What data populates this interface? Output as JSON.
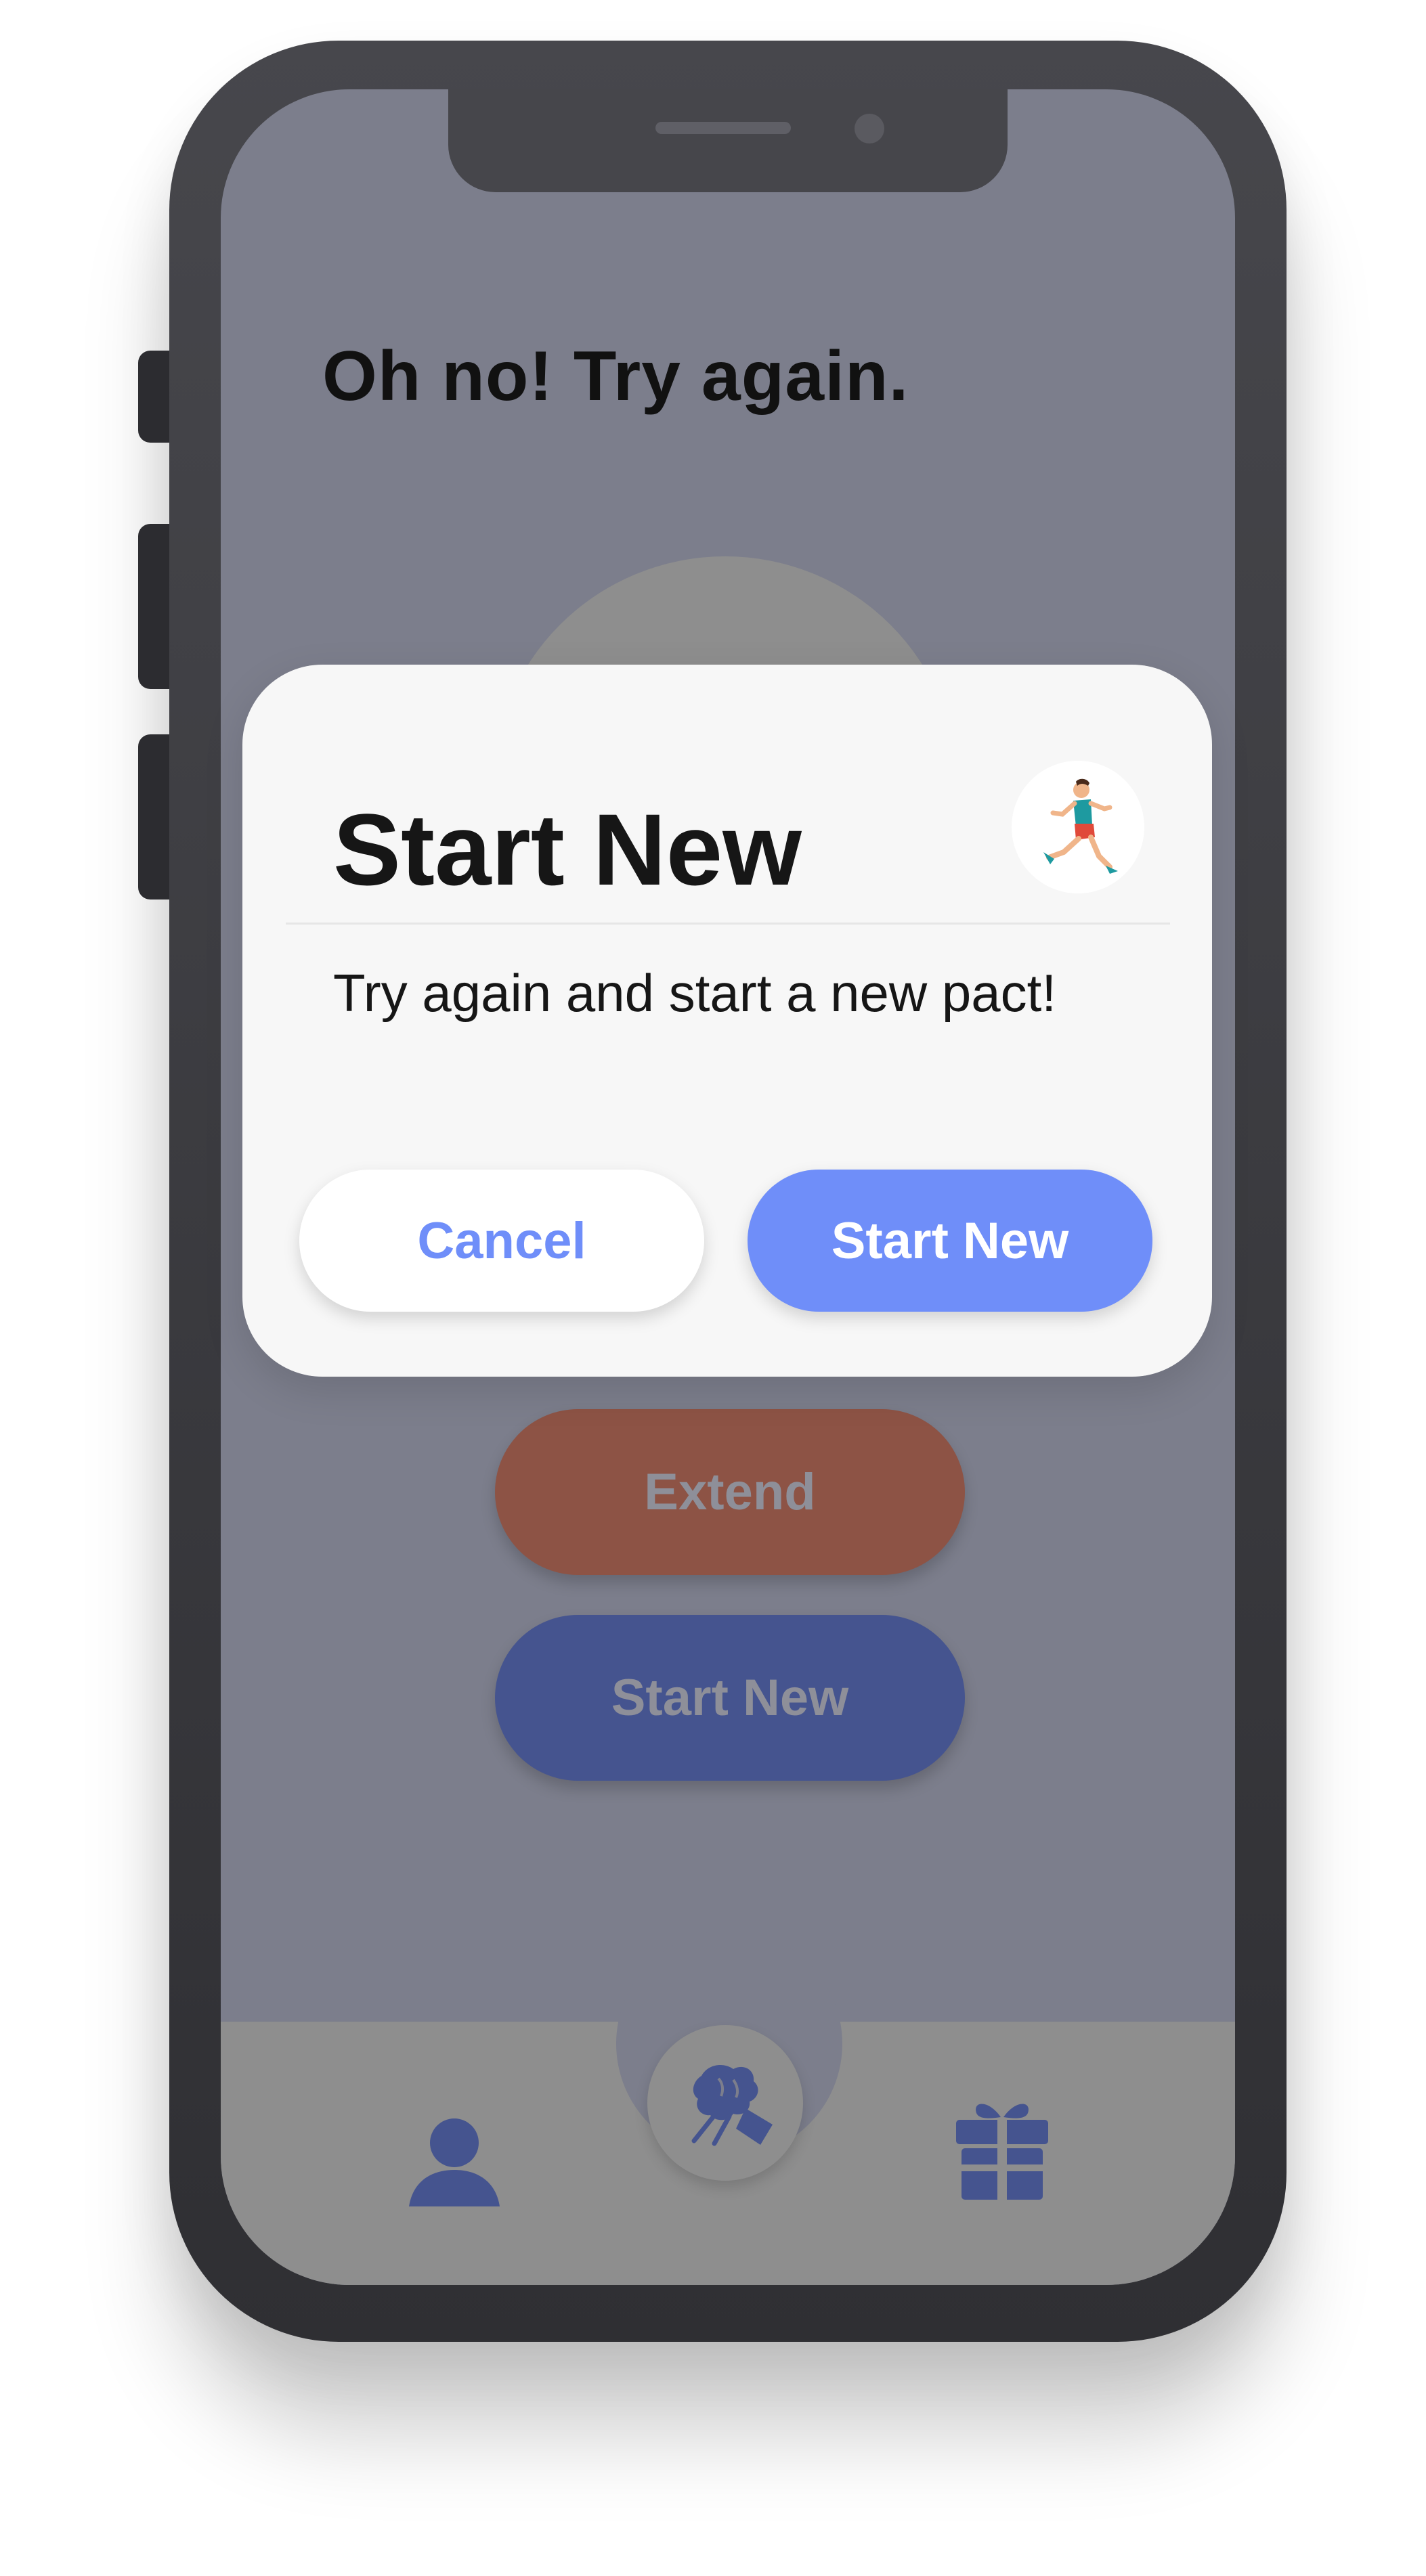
{
  "screen": {
    "heading": "Oh no! Try again.",
    "actions": {
      "extend_label": "Extend",
      "start_new_label": "Start New"
    }
  },
  "tab_bar": {
    "items": [
      {
        "icon": "profile-icon"
      },
      {
        "icon": "handshake-icon"
      },
      {
        "icon": "gift-icon"
      }
    ]
  },
  "modal": {
    "title": "Start New",
    "icon": "runner-icon",
    "message": "Try again and start a new pact!",
    "cancel_label": "Cancel",
    "confirm_label": "Start New"
  },
  "colors": {
    "accent": "#6f8ef9",
    "extend": "#8d5345",
    "start_new_dimmed": "#45548f",
    "overlay": "#7c7e8c"
  }
}
